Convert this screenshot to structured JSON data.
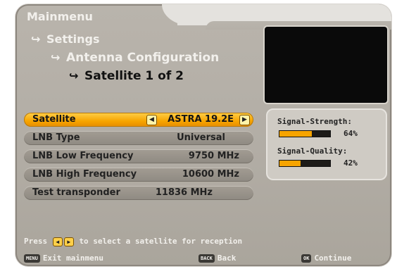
{
  "breadcrumb": {
    "root": "Mainmenu",
    "level1": "Settings",
    "level2": "Antenna Configuration",
    "level3": "Satellite 1 of 2"
  },
  "menu": [
    {
      "label": "Satellite",
      "value": "ASTRA 19.2E",
      "active": true
    },
    {
      "label": "LNB Type",
      "value": "Universal"
    },
    {
      "label": "LNB Low Frequency",
      "value": "9750 MHz"
    },
    {
      "label": "LNB High Frequency",
      "value": "10600 MHz"
    },
    {
      "label": "Test transponder",
      "value": "11836 MHz"
    }
  ],
  "signal": {
    "strength_label": "Signal-Strength:",
    "strength_value": "64%",
    "strength_fraction": 0.64,
    "quality_label": "Signal-Quality:",
    "quality_value": "42%",
    "quality_fraction": 0.42
  },
  "hint": {
    "prefix": "Press",
    "suffix": "to select a satellite for reception"
  },
  "footer": {
    "menu_key": "MENU",
    "menu_label": "Exit mainmenu",
    "back_key": "BACK",
    "back_label": "Back",
    "ok_key": "OK",
    "ok_label": "Continue"
  },
  "colors": {
    "accent": "#f7a400",
    "panel": "#b2ada5"
  }
}
